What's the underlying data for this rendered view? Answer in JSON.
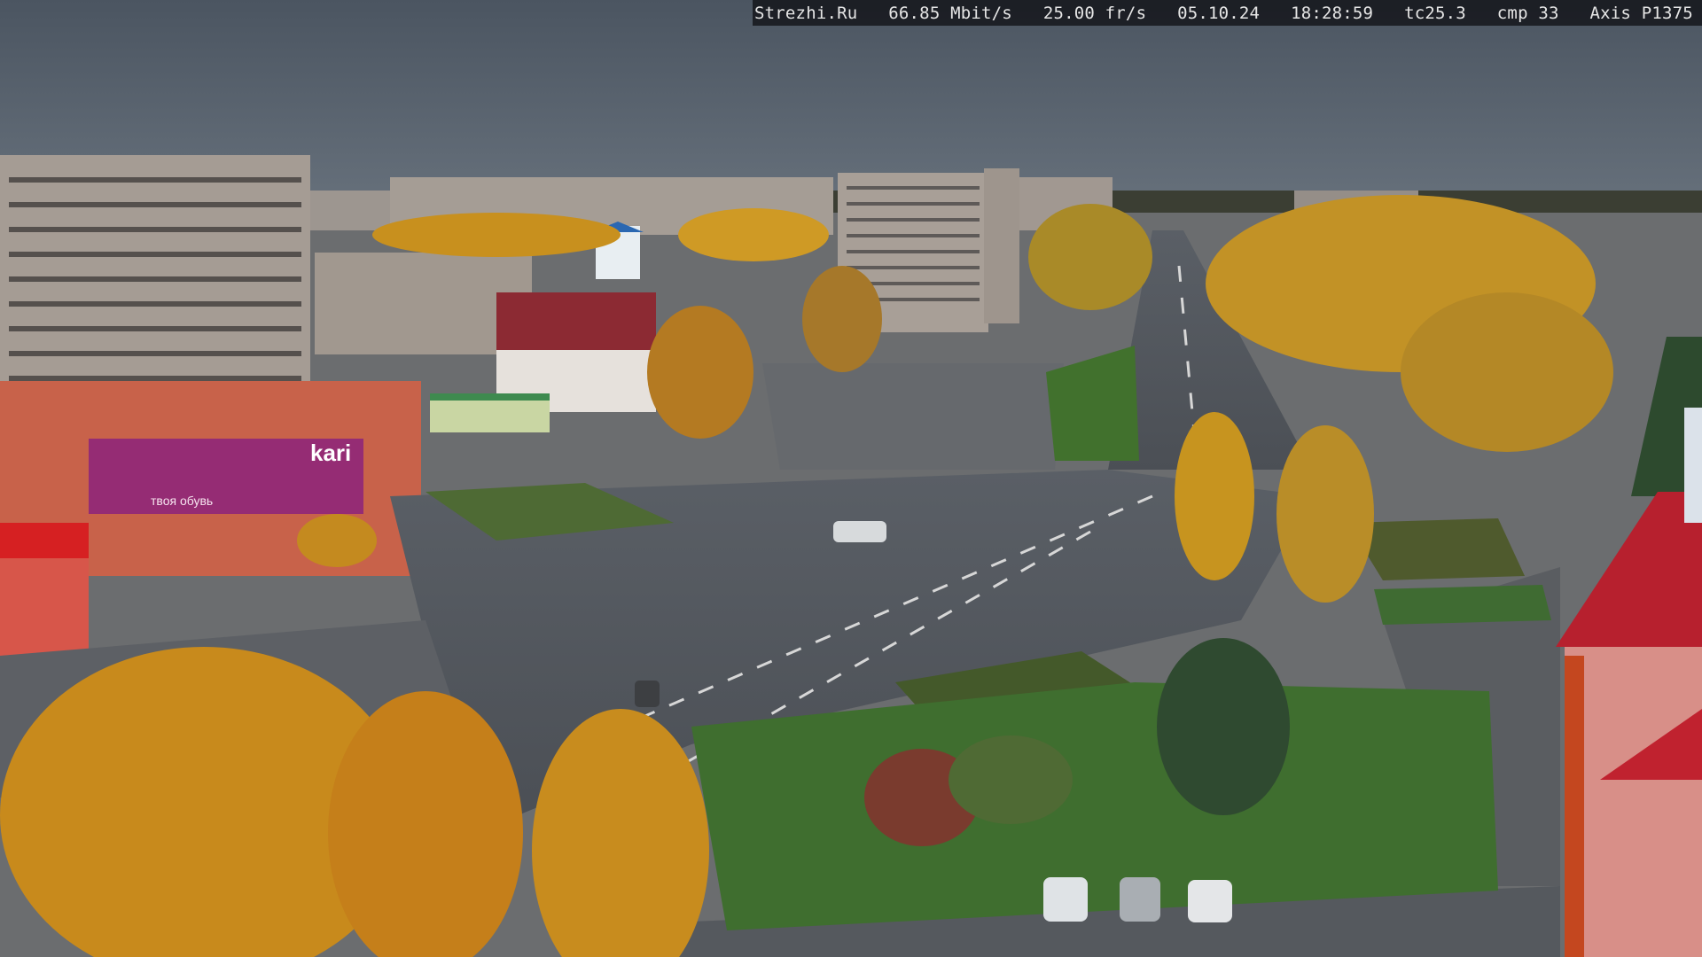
{
  "overlay": {
    "site": "Strezhi.Ru",
    "bitrate": "66.85 Mbit/s",
    "framerate": "25.00 fr/s",
    "date": "05.10.24",
    "time": "18:28:59",
    "tc": "tc25.3",
    "cmp": "cmp 33",
    "camera": "Axis P1375"
  },
  "signs": {
    "store_brand": "kari",
    "store_slogan": "твоя обувь"
  },
  "colors": {
    "sky": "#4e5966",
    "overlay_text": "#e6e6e6",
    "foliage": "#c8901e",
    "roof_red": "#b7202e"
  }
}
